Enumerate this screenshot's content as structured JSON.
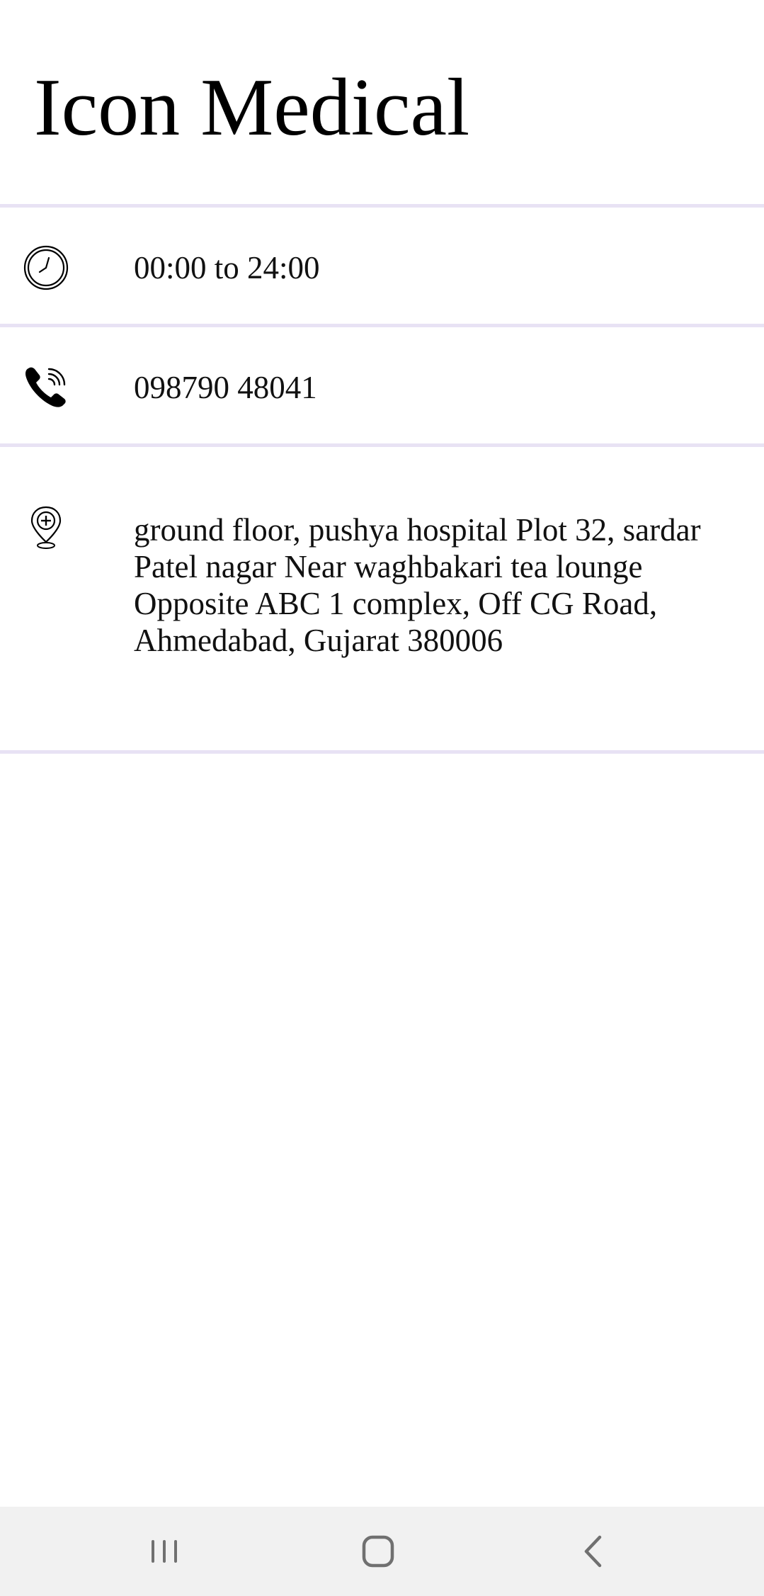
{
  "header": {
    "title": "Icon Medical"
  },
  "details": {
    "hours": {
      "icon": "clock-icon",
      "text": "00:00 to 24:00"
    },
    "phone": {
      "icon": "phone-icon",
      "text": "098790 48041"
    },
    "address": {
      "icon": "medical-location-pin-icon",
      "text": "ground floor, pushya hospital Plot 32, sardar Patel nagar Near waghbakari tea lounge Opposite ABC 1 complex, Off CG Road, Ahmedabad, Gujarat 380006"
    }
  },
  "navbar": {
    "recents": "recent-apps-icon",
    "home": "home-icon",
    "back": "back-icon"
  },
  "colors": {
    "divider": "#e8e2f4",
    "navbar_bg": "#f1f1f1",
    "nav_icon": "#707070"
  }
}
